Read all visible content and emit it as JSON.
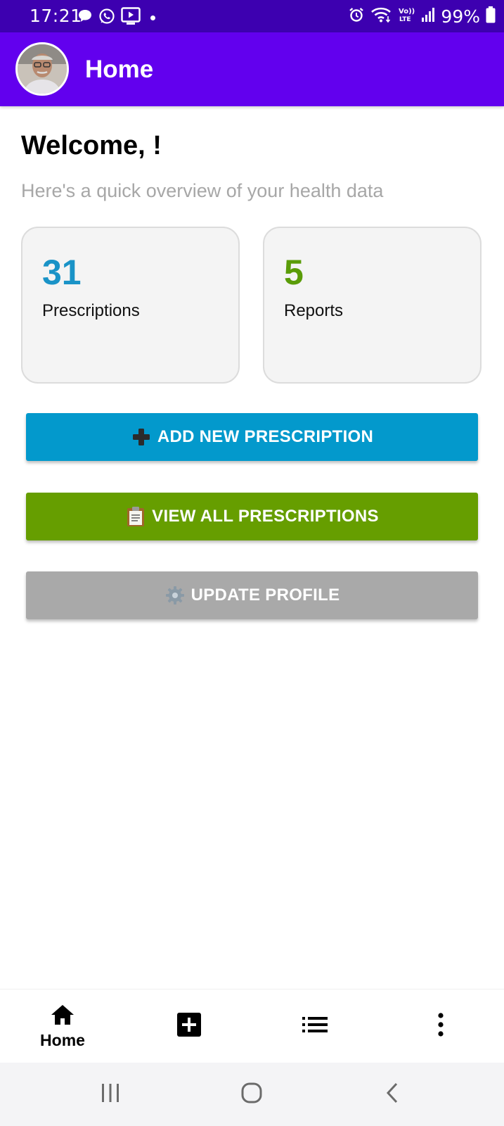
{
  "status_bar": {
    "time": "17:21",
    "battery": "99%",
    "left_icons": [
      "chat-bubble-icon",
      "whatsapp-icon",
      "youtube-icon",
      "notification-dot"
    ],
    "right_icons": [
      "alarm-icon",
      "wifi-icon",
      "volte-icon",
      "signal-icon",
      "battery-icon"
    ]
  },
  "app_bar": {
    "title": "Home",
    "avatar": "user-avatar"
  },
  "main": {
    "welcome": "Welcome, !",
    "subtitle": "Here's a quick overview of your health data",
    "stats": [
      {
        "count": "31",
        "label": "Prescriptions",
        "color": "#1a93c7"
      },
      {
        "count": "5",
        "label": "Reports",
        "color": "#5a9c08"
      }
    ],
    "actions": [
      {
        "label": "ADD NEW PRESCRIPTION",
        "icon": "plus-icon",
        "color": "#0399cc"
      },
      {
        "label": "VIEW ALL PRESCRIPTIONS",
        "icon": "clipboard-icon",
        "color": "#669e00"
      },
      {
        "label": "UPDATE PROFILE",
        "icon": "gear-icon",
        "color": "#a9a9a9"
      }
    ]
  },
  "bottom_nav": {
    "items": [
      {
        "label": "Home",
        "icon": "home-icon",
        "active": true
      },
      {
        "label": "",
        "icon": "add-box-icon"
      },
      {
        "label": "",
        "icon": "list-icon"
      },
      {
        "label": "",
        "icon": "more-vert-icon"
      }
    ]
  },
  "system_nav": {
    "buttons": [
      "recents-icon",
      "home-circle-icon",
      "back-icon"
    ]
  },
  "colors": {
    "status_bar": "#3d00b0",
    "app_bar": "#6200ee"
  }
}
